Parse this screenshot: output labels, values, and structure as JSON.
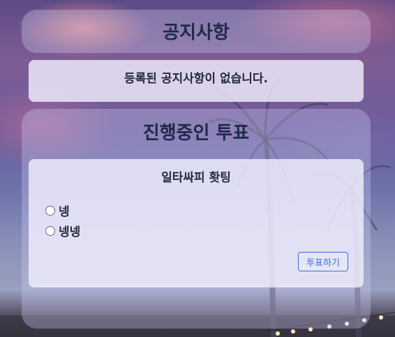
{
  "notice": {
    "title": "공지사항",
    "empty_message": "등록된 공지사항이 없습니다."
  },
  "poll": {
    "section_title": "진행중인 투표",
    "question": "일타싸피 홧팅",
    "options": [
      {
        "label": "넹",
        "selected": false
      },
      {
        "label": "넹넹",
        "selected": false
      }
    ],
    "vote_button": "투표하기"
  }
}
